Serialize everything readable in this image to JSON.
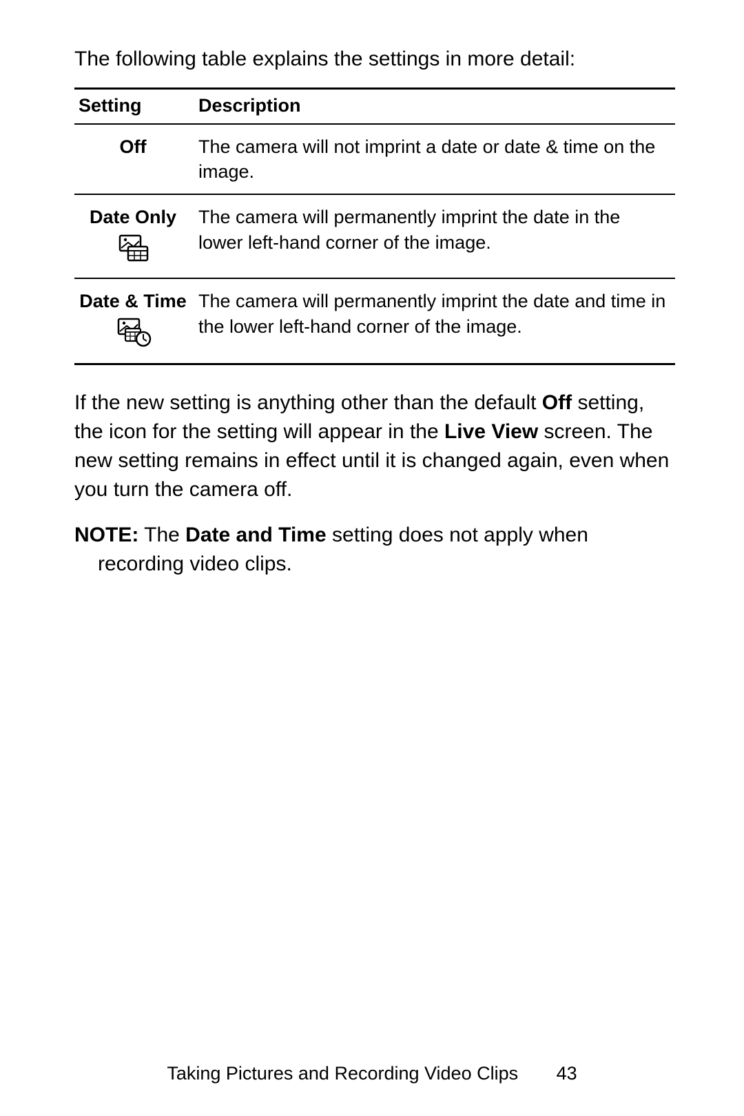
{
  "intro": "The following table explains the settings in more detail:",
  "table": {
    "headers": {
      "setting": "Setting",
      "description": "Description"
    },
    "rows": [
      {
        "label": "Off",
        "icon": "none",
        "desc": "The camera will not imprint a date or date & time on the image."
      },
      {
        "label": "Date Only",
        "icon": "date-only",
        "desc": "The camera will permanently imprint the date in the lower left-hand corner of the image."
      },
      {
        "label": "Date & Time",
        "icon": "date-time",
        "desc": "The camera will permanently imprint the date and time in the lower left-hand corner of the image."
      }
    ]
  },
  "paragraph": {
    "p1": "If the new setting is anything other than the default ",
    "b1": "Off",
    "p2": " setting, the icon for the setting will appear in the ",
    "b2": "Live View",
    "p3": " screen. The new setting remains in effect until it is changed again, even when you turn the camera off."
  },
  "note": {
    "label": "NOTE:",
    "p1": "  The ",
    "b1": "Date and Time",
    "p2": " setting does not apply when recording video clips."
  },
  "footer": {
    "section": "Taking Pictures and Recording Video Clips",
    "page": "43"
  }
}
